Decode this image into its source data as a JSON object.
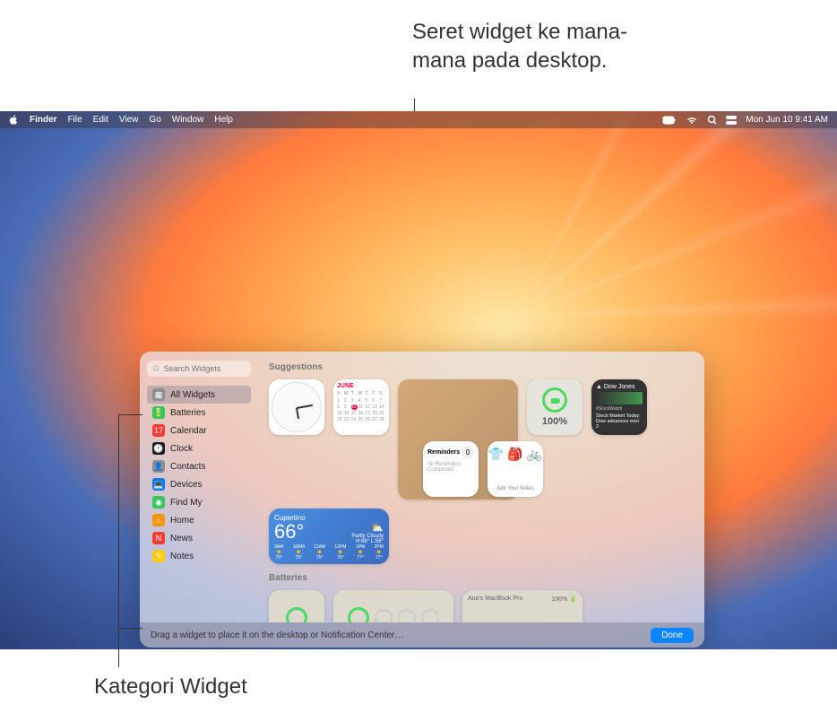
{
  "annotations": {
    "top": "Seret widget ke mana-mana pada desktop.",
    "bottom": "Kategori Widget"
  },
  "menubar": {
    "app": "Finder",
    "menus": [
      "File",
      "Edit",
      "View",
      "Go",
      "Window",
      "Help"
    ],
    "datetime": "Mon Jun 10  9:41 AM"
  },
  "gallery": {
    "search_placeholder": "Search Widgets",
    "footer_hint": "Drag a widget to place it on the desktop or Notification Center…",
    "done": "Done",
    "categories": [
      {
        "icon": "▦",
        "bg": "#8e8e93",
        "label": "All Widgets",
        "sel": true
      },
      {
        "icon": "🔋",
        "bg": "#34c759",
        "label": "Batteries"
      },
      {
        "icon": "17",
        "bg": "#ff3b30",
        "label": "Calendar"
      },
      {
        "icon": "🕐",
        "bg": "#1c1c1e",
        "label": "Clock"
      },
      {
        "icon": "👤",
        "bg": "#8e8e93",
        "label": "Contacts"
      },
      {
        "icon": "💻",
        "bg": "#007aff",
        "label": "Devices"
      },
      {
        "icon": "◉",
        "bg": "#34c759",
        "label": "Find My"
      },
      {
        "icon": "⌂",
        "bg": "#ff9500",
        "label": "Home"
      },
      {
        "icon": "N",
        "bg": "#ff3b30",
        "label": "News"
      },
      {
        "icon": "✎",
        "bg": "#ffcc00",
        "label": "Notes"
      }
    ],
    "sections": {
      "suggestions": "Suggestions",
      "batteries": "Batteries"
    },
    "widgets": {
      "calendar": {
        "month": "JUNE",
        "days": [
          "S",
          "M",
          "T",
          "W",
          "T",
          "F",
          "S"
        ]
      },
      "weather": {
        "location": "Cupertino",
        "temp": "66°",
        "condition": "Partly Cloudy",
        "hilo": "H:66° L:56°",
        "hours": [
          {
            "t": "9AM",
            "d": "75°"
          },
          {
            "t": "10AM",
            "d": "75°"
          },
          {
            "t": "11AM",
            "d": "75°"
          },
          {
            "t": "12PM",
            "d": "76°"
          },
          {
            "t": "1PM",
            "d": "77°"
          },
          {
            "t": "2PM",
            "d": "77°"
          }
        ]
      },
      "battery_pct": "100%",
      "stocks": {
        "symbol": "▲ Dow Jones",
        "name": "#StockWatch",
        "headline": "Stock Market Today: Dow advances over 2"
      },
      "reminders": {
        "title": "Reminders",
        "count": "0",
        "sub": "All Reminders Completed"
      },
      "notes": {
        "label": "Add Your Notes"
      }
    }
  }
}
